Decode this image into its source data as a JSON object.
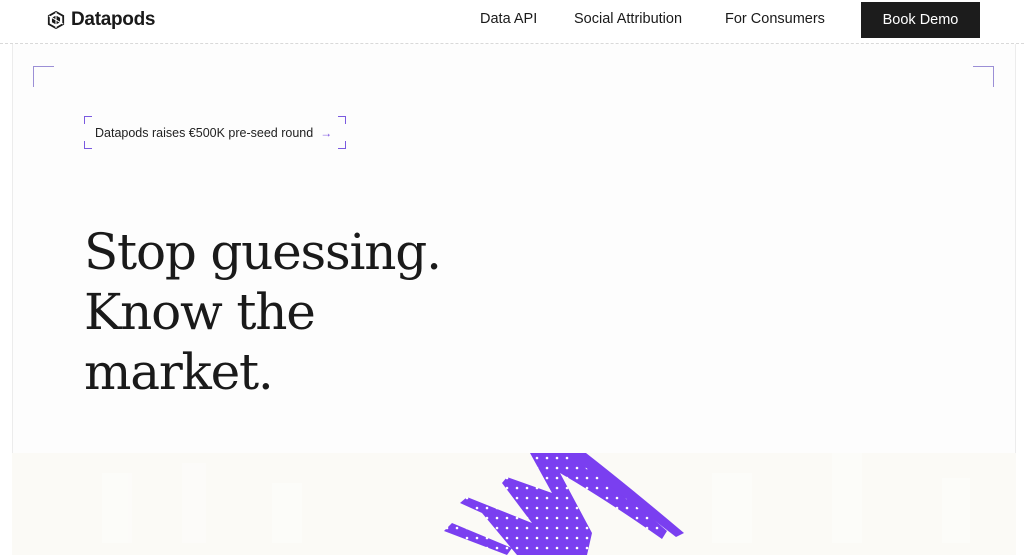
{
  "header": {
    "brand": "Datapods",
    "nav": [
      {
        "label": "Data API"
      },
      {
        "label": "Social Attribution"
      },
      {
        "label": "For Consumers"
      }
    ],
    "cta_label": "Book Demo"
  },
  "announcement": {
    "text": "Datapods raises €500K pre-seed round",
    "arrow": "→"
  },
  "hero": {
    "lines": [
      "Stop guessing.",
      "Know the",
      "market."
    ]
  },
  "colors": {
    "accent": "#7a4fe0",
    "corner": "#9b8fd6",
    "cta_bg": "#1c1c1c",
    "stroke": "#7a3ff0"
  },
  "icons": {
    "logo": "datapods-logo-icon",
    "arrow": "arrow-right-icon"
  }
}
